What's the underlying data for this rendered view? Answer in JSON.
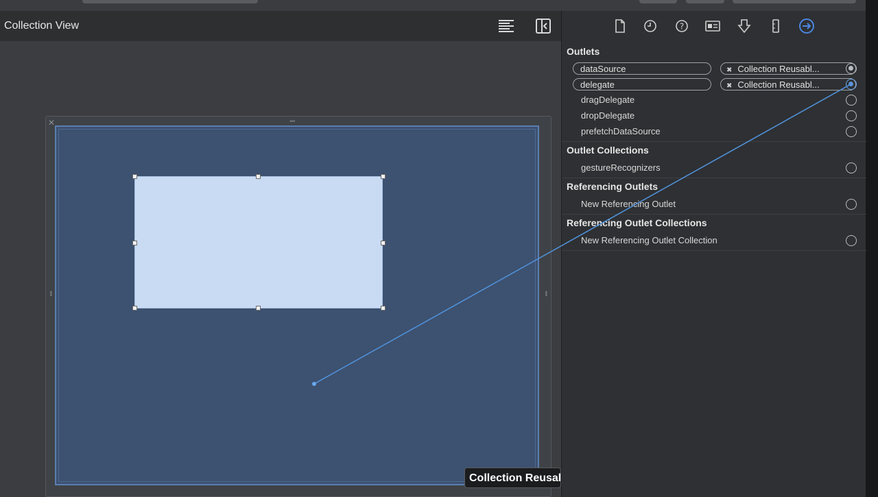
{
  "canvas": {
    "title": "Collection View",
    "tooltip": "Collection Reusable View"
  },
  "inspector": {
    "tabs": [
      "file-icon",
      "history-icon",
      "help-icon",
      "identity-icon",
      "attributes-icon",
      "size-icon",
      "connections-icon"
    ],
    "outlets_title": "Outlets",
    "outlets": [
      {
        "name": "dataSource",
        "target": "Collection Reusabl..."
      },
      {
        "name": "delegate",
        "target": "Collection Reusabl..."
      },
      {
        "name": "dragDelegate"
      },
      {
        "name": "dropDelegate"
      },
      {
        "name": "prefetchDataSource"
      }
    ],
    "outlet_collections_title": "Outlet Collections",
    "outlet_collections": [
      {
        "name": "gestureRecognizers"
      }
    ],
    "referencing_outlets_title": "Referencing Outlets",
    "referencing_outlets": [
      {
        "name": "New Referencing Outlet"
      }
    ],
    "referencing_collections_title": "Referencing Outlet Collections",
    "referencing_collections": [
      {
        "name": "New Referencing Outlet Collection"
      }
    ]
  },
  "colors": {
    "accent": "#5a93d8",
    "collection_view_fill": "#3d5170",
    "cell_fill": "#c9dbf3"
  }
}
